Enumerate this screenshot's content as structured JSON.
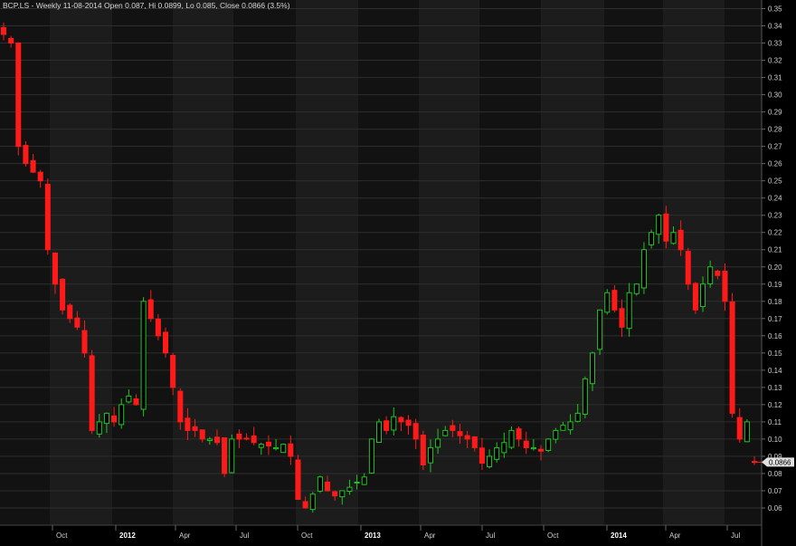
{
  "chart_data": {
    "type": "candlestick",
    "title": "BCP.LS - Weekly 11-08-2014 Open 0.087, Hi 0.0899, Lo 0.085, Close 0.0866 (3.5%)",
    "ylim": [
      0.05,
      0.355
    ],
    "y_ticks": [
      0.06,
      0.07,
      0.08,
      0.09,
      0.1,
      0.11,
      0.12,
      0.13,
      0.14,
      0.15,
      0.16,
      0.17,
      0.18,
      0.19,
      0.2,
      0.21,
      0.22,
      0.23,
      0.24,
      0.25,
      0.26,
      0.27,
      0.28,
      0.29,
      0.3,
      0.31,
      0.32,
      0.33,
      0.34,
      0.35
    ],
    "x_labels": [
      "Oct",
      "2012",
      "Apr",
      "Jul",
      "Oct",
      "2013",
      "Apr",
      "Jul",
      "Oct",
      "2014",
      "Apr",
      "Jul"
    ],
    "last_price": "0.0866",
    "colors": {
      "up": "#22c422",
      "down": "#ff1a1a",
      "background": "#121212",
      "band": "#1c1c1c",
      "grid": "#2e2e2e",
      "text": "#d0d0d0"
    },
    "path": [
      0.335,
      0.33,
      0.27,
      0.26,
      0.255,
      0.25,
      0.21,
      0.19,
      0.175,
      0.17,
      0.165,
      0.15,
      0.105,
      0.11,
      0.115,
      0.11,
      0.12,
      0.125,
      0.12,
      0.18,
      0.17,
      0.16,
      0.15,
      0.13,
      0.11,
      0.105,
      0.105,
      0.1,
      0.1,
      0.098,
      0.08,
      0.1,
      0.1,
      0.1,
      0.098,
      0.097,
      0.096,
      0.095,
      0.097,
      0.09,
      0.065,
      0.06,
      0.068,
      0.078,
      0.07,
      0.067,
      0.07,
      0.072,
      0.075,
      0.078,
      0.1,
      0.11,
      0.105,
      0.113,
      0.11,
      0.108,
      0.1,
      0.085,
      0.095,
      0.1,
      0.105,
      0.105,
      0.102,
      0.1,
      0.095,
      0.086,
      0.09,
      0.095,
      0.098,
      0.105,
      0.1,
      0.095,
      0.095,
      0.093,
      0.1,
      0.105,
      0.108,
      0.11,
      0.115,
      0.135,
      0.15,
      0.175,
      0.185,
      0.175,
      0.165,
      0.185,
      0.19,
      0.21,
      0.22,
      0.23,
      0.215,
      0.22,
      0.21,
      0.19,
      0.175,
      0.19,
      0.2,
      0.195,
      0.18,
      0.115,
      0.1,
      0.11,
      0.0866
    ]
  }
}
